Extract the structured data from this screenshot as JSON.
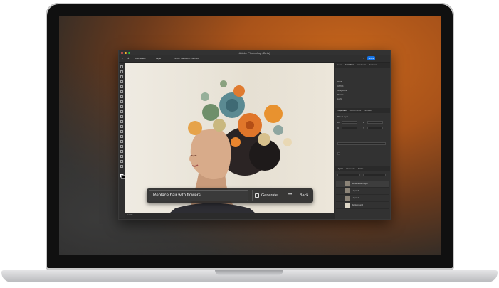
{
  "window": {
    "title": "Adobe Photoshop (Beta)",
    "share_label": "Share"
  },
  "options_bar": {
    "items": [
      "Auto-Select",
      "Layer",
      "Show Transform Controls"
    ]
  },
  "canvas": {
    "status_text": "100%"
  },
  "panels": {
    "top_tabs": [
      "Color",
      "Swatches",
      "Gradients",
      "Patterns"
    ],
    "top_active_tab": 1,
    "swatch_groups": [
      "RGB",
      "CMYK",
      "Grayscale",
      "Pastel",
      "Light"
    ],
    "properties_tabs": [
      "Properties",
      "Adjustments",
      "Libraries"
    ],
    "properties_header": "Pixel Layer",
    "properties_rows": [
      "W",
      "H",
      "X",
      "Y"
    ],
    "layers_tabs": [
      "Layers",
      "Channels",
      "Paths"
    ],
    "layers": [
      "Generative Layer",
      "Layer 2",
      "Layer 1",
      "Background"
    ]
  },
  "generative_bar": {
    "prompt": "Replace hair with flowers",
    "generate_label": "Generate",
    "more_label": "•••",
    "back_label": "Back"
  },
  "colors": {
    "accent": "#1473e6",
    "orange_flower": "#e0762a",
    "teal_flower": "#5b8a92"
  }
}
